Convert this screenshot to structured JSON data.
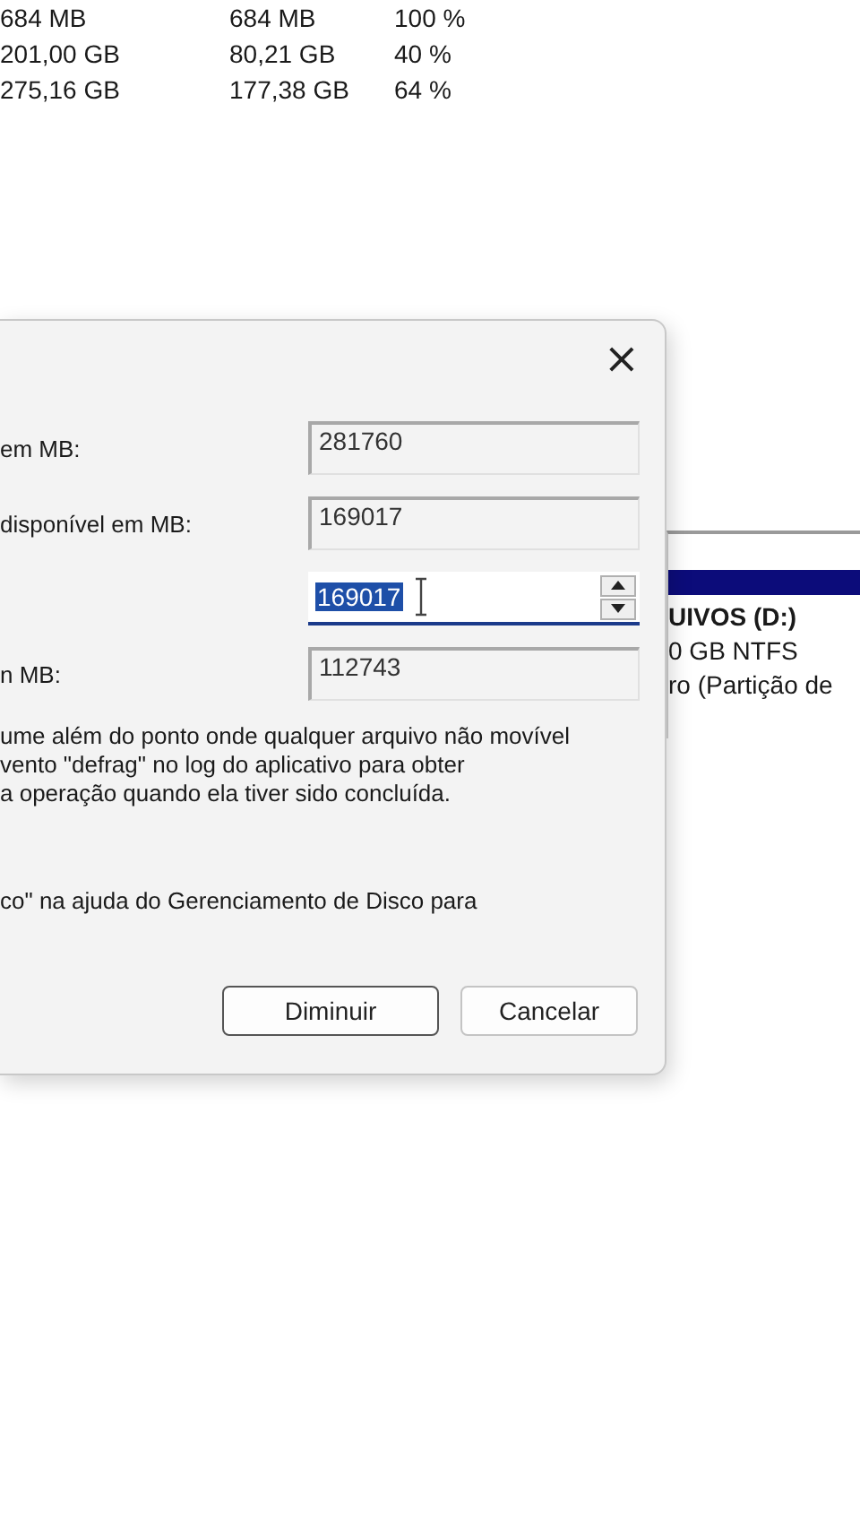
{
  "volume_table": {
    "rows": [
      {
        "cells": [
          "684 MB",
          "684 MB",
          "100 %"
        ]
      },
      {
        "cells": [
          "201,00 GB",
          "80,21 GB",
          "40 %"
        ]
      },
      {
        "cells": [
          "275,16 GB",
          "177,38 GB",
          "64 %"
        ]
      }
    ]
  },
  "partition_panel": {
    "lines": [
      "UIVOS  (D:)",
      "0 GB NTFS",
      "ro (Partição de"
    ]
  },
  "shrink_dialog": {
    "close": "×",
    "fields": [
      {
        "kind": "readonly",
        "label": "em MB:",
        "value": "281760"
      },
      {
        "kind": "readonly",
        "label": "disponível em MB:",
        "value": "169017"
      },
      {
        "kind": "spin",
        "value": "169017",
        "selected": true
      },
      {
        "kind": "readonly",
        "label": "n MB:",
        "value": "112743"
      }
    ],
    "note_lines": [
      "ume além do ponto onde qualquer arquivo não movível",
      "vento \"defrag\" no log do aplicativo para obter",
      "a operação quando ela tiver sido concluída."
    ],
    "help_line": "co\" na ajuda do Gerenciamento de Disco para",
    "buttons": [
      {
        "label": "Diminuir",
        "default": true
      },
      {
        "label": "Cancelar",
        "default": false
      }
    ]
  }
}
